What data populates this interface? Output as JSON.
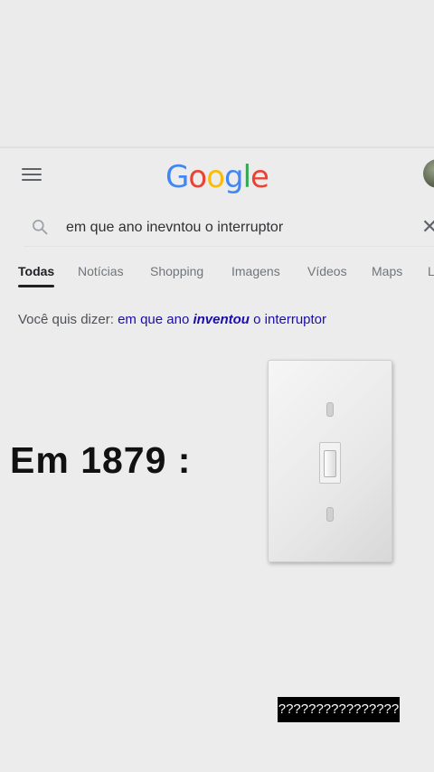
{
  "header": {
    "logo": {
      "letters": [
        "G",
        "o",
        "o",
        "g",
        "l",
        "e"
      ],
      "colors": [
        "#4285F4",
        "#EA4335",
        "#FBBC05",
        "#4285F4",
        "#34A853",
        "#EA4335"
      ]
    },
    "menu_icon": "hamburger-menu-icon",
    "avatar_icon": "account-avatar"
  },
  "search": {
    "query": "em que ano inevntou o interruptor",
    "search_icon": "search-icon",
    "clear_icon": "close-icon",
    "clear_glyph": "✕"
  },
  "tabs": [
    {
      "label": "Todas",
      "active": true
    },
    {
      "label": "Notícias",
      "active": false
    },
    {
      "label": "Shopping",
      "active": false
    },
    {
      "label": "Imagens",
      "active": false
    },
    {
      "label": "Vídeos",
      "active": false
    },
    {
      "label": "Maps",
      "active": false
    },
    {
      "label": "L",
      "active": false
    }
  ],
  "suggestion": {
    "prefix": "Você quis dizer: ",
    "part1": "em que ano ",
    "emphasis": "inventou",
    "part2": " o interruptor"
  },
  "meme": {
    "headline": "Em 1879 :",
    "image_icon": "light-switch-image",
    "caption": "????????????????"
  },
  "colors": {
    "background": "#ececec",
    "link": "#1a0dab",
    "caption_bg": "#000000"
  }
}
